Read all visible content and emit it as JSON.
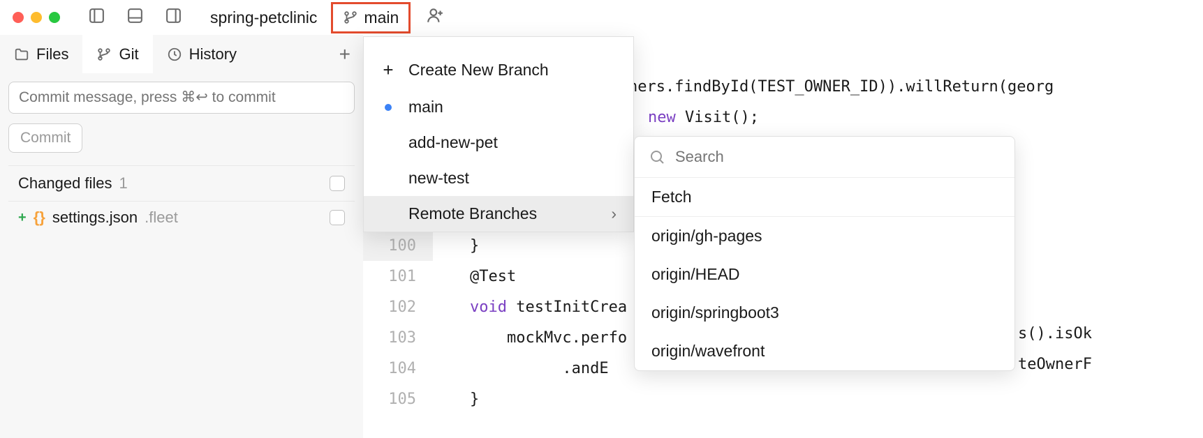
{
  "titlebar": {
    "project_name": "spring-petclinic",
    "branch_label": "main"
  },
  "tabs": {
    "files": "Files",
    "git": "Git",
    "history": "History"
  },
  "sidebar": {
    "commit_placeholder": "Commit message, press ⌘↩ to commit",
    "commit_btn": "Commit",
    "changed_files_label": "Changed files",
    "changed_count": "1",
    "file": {
      "name": "settings.json",
      "dir": ".fleet"
    }
  },
  "branch_popup": {
    "create": "Create New Branch",
    "items": [
      "main",
      "add-new-pet",
      "new-test"
    ],
    "remote_label": "Remote Branches"
  },
  "remote_popup": {
    "search_placeholder": "Search",
    "fetch": "Fetch",
    "items": [
      "origin/gh-pages",
      "origin/HEAD",
      "origin/springboot3",
      "origin/wavefront"
    ]
  },
  "editor": {
    "top_frag_1": "ners.findById(TEST_OWNER_ID)).willReturn(georg",
    "top_frag_2a": "new",
    "top_frag_2b": " Visit();",
    "right_frag_1": "s().isOk",
    "right_frag_2": "teOwnerF",
    "lines": [
      {
        "num": "100",
        "text": "    }"
      },
      {
        "num": "101",
        "text": "    @Test"
      },
      {
        "num": "102",
        "text_pre": "    ",
        "kw": "void",
        "text_post": " testInitCrea"
      },
      {
        "num": "103",
        "text": "        mockMvc.perfo"
      },
      {
        "num": "104",
        "text": "              .andE"
      },
      {
        "num": "105",
        "text": "    }"
      }
    ]
  }
}
